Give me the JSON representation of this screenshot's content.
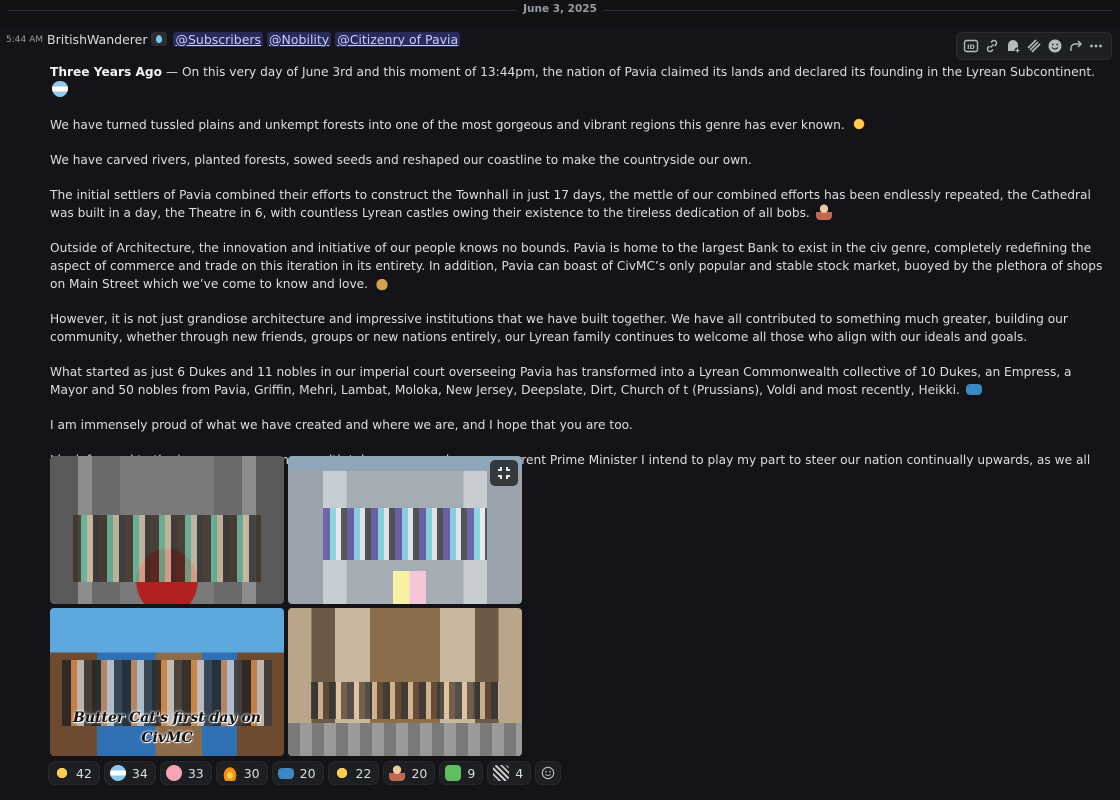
{
  "date_divider": "June 3, 2025",
  "message": {
    "timestamp": "5:44 AM",
    "username": "BritishWanderer",
    "mentions": [
      "@Subscribers",
      "@Nobility",
      "@Citizenry of Pavia"
    ],
    "title": "Three Years Ago",
    "paragraphs": [
      " — On this very day of June 3rd and this moment of 13:44pm, the nation of Pavia claimed its lands and declared its founding in the Lyrean Subcontinent.",
      "We have turned tussled plains and unkempt forests into one of the most gorgeous and vibrant regions this genre has ever known.",
      "We have carved rivers, planted forests, sowed seeds and reshaped our coastline to make the countryside our own.",
      "The initial settlers of Pavia combined their efforts to construct the Townhall in just 17 days, the mettle of our combined efforts has been endlessly repeated, the Cathedral was built in a day, the Theatre in 6, with countless Lyrean castles owing their existence to the tireless dedication of all bobs.",
      "Outside of Architecture, the innovation and initiative of our people knows no bounds. Pavia is home to the largest Bank to exist in the civ genre, completely redefining the aspect of commerce and trade on this iteration in its entirety. In addition, Pavia can boast of CivMC’s only popular and stable stock market, buoyed by the plethora of shops on Main Street which we’ve come to know and love.",
      "However, it is not just grandiose architecture and impressive institutions that we have built together. We have all contributed to something much greater, building our community, whether through new friends, groups or new nations entirely, our Lyrean family continues to welcome all those who align with our ideals and goals.",
      "What started as just 6 Dukes and 11 nobles in our imperial court overseeing Pavia has transformed into a Lyrean Commonwealth collective of 10 Dukes, an Empress, a Mayor and 50 nobles from Pavia, Griffin, Mehri, Lambat, Moloka, New Jersey, Deepslate, Dirt, Church of t (Prussians), Voldi and most recently, Heikki.",
      "I am immensely proud of what we have created and where we are, and I hope that you are too.",
      "I look forward to the journey our commonwealth takes us on, and as your current Prime Minister I intend to play my part to steer our nation continually upwards, as we all do."
    ],
    "inline_emojis": [
      "blue-white-heart",
      "sun",
      "person",
      "money-bag",
      "flag",
      "pink-heart"
    ],
    "image_caption": "Butter Cat's first day on CivMC"
  },
  "toolbar": {
    "icons": [
      "id-icon",
      "link-icon",
      "thread-icon",
      "stripes-icon",
      "emoji-icon",
      "forward-icon",
      "more-icon"
    ]
  },
  "reactions": [
    {
      "emoji": "star",
      "count": "42"
    },
    {
      "emoji": "blue-white-heart",
      "count": "34"
    },
    {
      "emoji": "pink-heart",
      "count": "33"
    },
    {
      "emoji": "fire",
      "count": "30"
    },
    {
      "emoji": "flag",
      "count": "20"
    },
    {
      "emoji": "cool-face",
      "count": "22"
    },
    {
      "emoji": "person",
      "count": "20"
    },
    {
      "emoji": "creeper",
      "count": "9"
    },
    {
      "emoji": "stripes",
      "count": "4"
    }
  ],
  "colors": {
    "background": "#121214",
    "text": "#dbdee1",
    "mention_bg": "#3c4270",
    "mention_text": "#c9cdfb",
    "muted": "#949ba4"
  }
}
